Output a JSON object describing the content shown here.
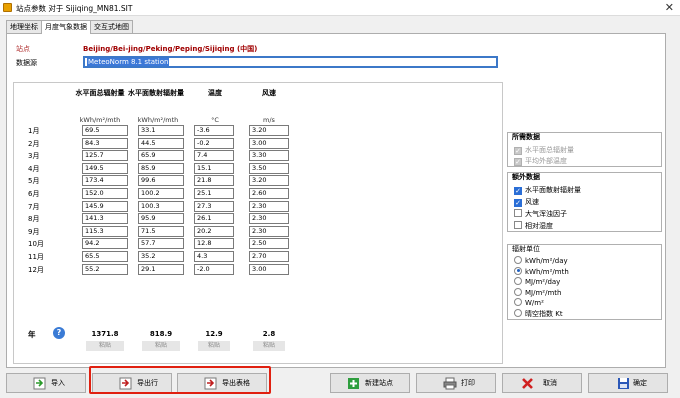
{
  "window": {
    "title": "站点参数 对于 Sijiqing_MN81.SIT"
  },
  "tabs": [
    {
      "label": "地理坐标"
    },
    {
      "label": "月度气象数据"
    },
    {
      "label": "交互式地图"
    }
  ],
  "site": {
    "label": "站点",
    "value": "Beijing/Bei-jing/Peking/Peping/Sijiqing   (中国)"
  },
  "source": {
    "label": "数据源",
    "value": "MeteoNorm 8.1 station"
  },
  "columns": [
    {
      "header": "水平面总辐射量",
      "unit": "kWh/m²/mth"
    },
    {
      "header": "水平面散射辐射量",
      "unit": "kWh/m²/mth"
    },
    {
      "header": "温度",
      "unit": "°C"
    },
    {
      "header": "风速",
      "unit": "m/s"
    }
  ],
  "months": [
    "1月",
    "2月",
    "3月",
    "4月",
    "5月",
    "6月",
    "7月",
    "8月",
    "9月",
    "10月",
    "11月",
    "12月"
  ],
  "rows": [
    [
      "69.5",
      "33.1",
      "-3.6",
      "3.20"
    ],
    [
      "84.3",
      "44.5",
      "-0.2",
      "3.00"
    ],
    [
      "125.7",
      "65.9",
      "7.4",
      "3.30"
    ],
    [
      "149.5",
      "85.9",
      "15.1",
      "3.50"
    ],
    [
      "173.4",
      "99.6",
      "21.8",
      "3.20"
    ],
    [
      "152.0",
      "100.2",
      "25.1",
      "2.60"
    ],
    [
      "145.9",
      "100.3",
      "27.3",
      "2.30"
    ],
    [
      "141.3",
      "95.9",
      "26.1",
      "2.30"
    ],
    [
      "115.3",
      "71.5",
      "20.2",
      "2.30"
    ],
    [
      "94.2",
      "57.7",
      "12.8",
      "2.50"
    ],
    [
      "65.5",
      "35.2",
      "4.3",
      "2.70"
    ],
    [
      "55.2",
      "29.1",
      "-2.0",
      "3.00"
    ]
  ],
  "year": {
    "label": "年",
    "totals": [
      "1371.8",
      "818.9",
      "12.9",
      "2.8"
    ],
    "paste_label": "粘贴"
  },
  "required": {
    "title": "所需数据",
    "items": [
      {
        "label": "水平面总辐射量",
        "checked": true
      },
      {
        "label": "平均外部温度",
        "checked": true
      }
    ]
  },
  "extra": {
    "title": "额外数据",
    "items": [
      {
        "label": "水平面散射辐射量",
        "checked": true
      },
      {
        "label": "风速",
        "checked": true
      },
      {
        "label": "大气浑浊因子",
        "checked": false
      },
      {
        "label": "相对湿度",
        "checked": false
      }
    ]
  },
  "units": {
    "title": "辐射单位",
    "options": [
      "kWh/m²/day",
      "kWh/m²/mth",
      "MJ/m²/day",
      "MJ/m²/mth",
      "W/m²",
      "晴空指数 Kt"
    ],
    "selected_index": 1
  },
  "buttons": {
    "import": "导入",
    "export_row": "导出行",
    "export_table": "导出表格",
    "new_site": "新建站点",
    "print": "打印",
    "cancel": "取消",
    "ok": "确定"
  }
}
